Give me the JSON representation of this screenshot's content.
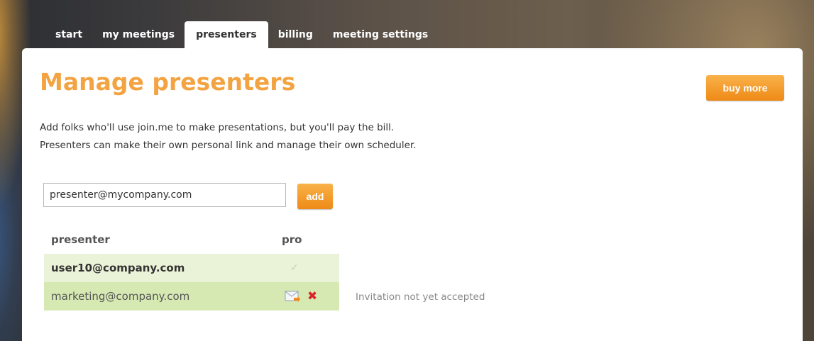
{
  "tabs": [
    {
      "label": "start"
    },
    {
      "label": "my meetings"
    },
    {
      "label": "presenters"
    },
    {
      "label": "billing"
    },
    {
      "label": "meeting settings"
    }
  ],
  "main": {
    "title": "Manage presenters",
    "buy_more_label": "buy more",
    "description_line1": "Add folks who'll use join.me to make presentations, but you'll pay the bill.",
    "description_line2": "Presenters can make their own personal link and manage their own scheduler.",
    "email_input_value": "presenter@mycompany.com",
    "add_label": "add"
  },
  "table": {
    "headers": {
      "presenter": "presenter",
      "pro": "pro"
    },
    "rows": [
      {
        "email": "user10@company.com",
        "pro_icon": "check-icon"
      },
      {
        "email": "marketing@company.com",
        "pro_icon": "mail-icon",
        "status": "Invitation not yet accepted"
      }
    ]
  },
  "colors": {
    "accent_orange": "#f3a341",
    "row_light_green": "#eaf3d7",
    "row_green": "#d7e9b3",
    "delete_red": "#d7262b"
  }
}
